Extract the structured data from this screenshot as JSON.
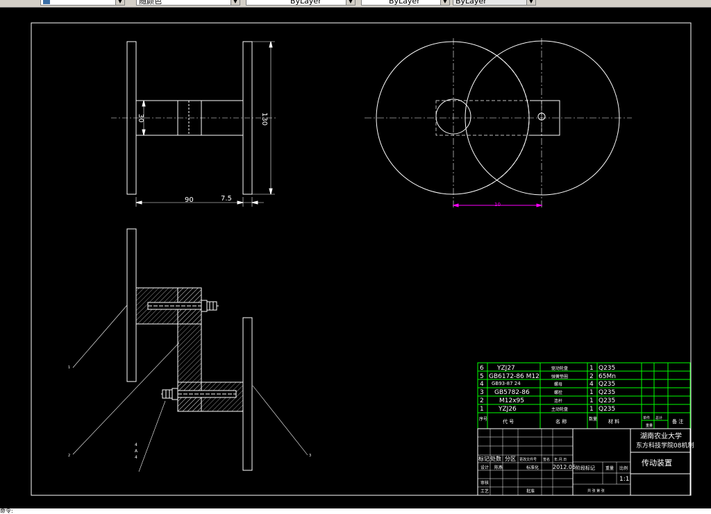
{
  "toolbar": {
    "linetype_value": "ByLayer",
    "lineweight_value": "ByLayer",
    "plotstyle_value": "ByLayer",
    "color_value": "随颜色"
  },
  "drawing": {
    "dims": {
      "d90": "90",
      "d75": "7.5",
      "d30": "30",
      "d130": "130",
      "pink": "10"
    },
    "balloons": [
      "1",
      "2",
      "3",
      "4"
    ],
    "frac": [
      "A",
      "4"
    ],
    "bom": [
      {
        "no": "6",
        "code": "YZJ27",
        "name": "驱动轮盘",
        "qty": "1",
        "material": "Q235"
      },
      {
        "no": "5",
        "code": "GB6172-86 M12",
        "name": "弹簧垫圈",
        "qty": "2",
        "material": "65Mn"
      },
      {
        "no": "4",
        "code": "GB93-87  24",
        "name": "螺母",
        "qty": "4",
        "material": "Q235"
      },
      {
        "no": "3",
        "code": "GB5782-86",
        "name": "螺栓",
        "qty": "1",
        "material": "Q235"
      },
      {
        "no": "2",
        "code": "M12x95",
        "name": "连杆",
        "qty": "1",
        "material": "Q235"
      },
      {
        "no": "1",
        "code": "YZJ26",
        "name": "主动轮盘",
        "qty": "1",
        "material": "Q235"
      }
    ],
    "bom_header": {
      "no": "序号",
      "code": "代  号",
      "name": "名  称",
      "qty": "数量",
      "material": "材  料",
      "unit_weight": "单件",
      "total_weight": "总计",
      "weight": "重量",
      "note": "备  注"
    },
    "title_block": {
      "school_line1": "湖南农业大学",
      "school_line2": "东方科技学院08机制",
      "drawing_name": "传动装置",
      "scale": "1:1",
      "date": "2012.06",
      "rev_headers": [
        "标记",
        "处数",
        "分区",
        "更改文件号",
        "签名",
        "年.月.日"
      ],
      "role_design": "设计",
      "role_review": "审核",
      "role_process": "工艺",
      "standard": "标准化",
      "approve": "批准",
      "stage_mark": "阶段标记",
      "weight_label": "重量",
      "scale_label": "比例",
      "sheet_info": "共 张  第 张",
      "signer": "陈燕"
    }
  },
  "status": {
    "text": "命令:"
  }
}
